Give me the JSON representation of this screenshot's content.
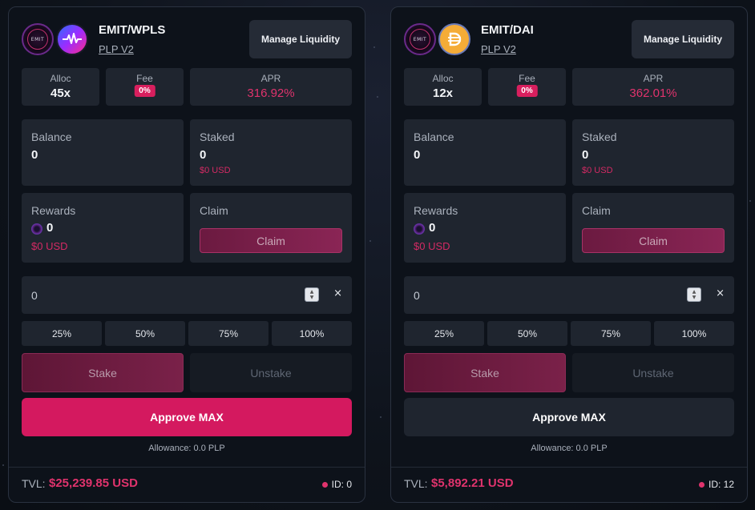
{
  "colors": {
    "accent": "#d4195f",
    "apr": "#e0336d",
    "panel": "#1f252f",
    "card": "#0d121a"
  },
  "cards": [
    {
      "pair": "EMIT/WPLS",
      "pool_type": "PLP V2",
      "logo_text": "EMIT",
      "token_icons": [
        "emit-icon",
        "pulsechain-icon"
      ],
      "manage_label": "Manage Liquidity",
      "alloc_label": "Alloc",
      "alloc_value": "45x",
      "fee_label": "Fee",
      "fee_value": "0%",
      "apr_label": "APR",
      "apr_value": "316.92%",
      "balance_label": "Balance",
      "balance_value": "0",
      "staked_label": "Staked",
      "staked_value": "0",
      "staked_usd": "$0 USD",
      "rewards_label": "Rewards",
      "rewards_value": "0",
      "rewards_usd": "$0 USD",
      "claim_title": "Claim",
      "claim_button": "Claim",
      "amount_value": "0",
      "clear_label": "×",
      "percents": [
        "25%",
        "50%",
        "75%",
        "100%"
      ],
      "stake_label": "Stake",
      "unstake_label": "Unstake",
      "approve_label": "Approve MAX",
      "allowance": "Allowance: 0.0 PLP",
      "tvl_label": "TVL:",
      "tvl_value": "$25,239.85 USD",
      "id_text": "ID: 0"
    },
    {
      "pair": "EMIT/DAI",
      "pool_type": "PLP V2",
      "logo_text": "EMIT",
      "token_icons": [
        "emit-icon",
        "dai-icon"
      ],
      "manage_label": "Manage Liquidity",
      "alloc_label": "Alloc",
      "alloc_value": "12x",
      "fee_label": "Fee",
      "fee_value": "0%",
      "apr_label": "APR",
      "apr_value": "362.01%",
      "balance_label": "Balance",
      "balance_value": "0",
      "staked_label": "Staked",
      "staked_value": "0",
      "staked_usd": "$0 USD",
      "rewards_label": "Rewards",
      "rewards_value": "0",
      "rewards_usd": "$0 USD",
      "claim_title": "Claim",
      "claim_button": "Claim",
      "amount_value": "0",
      "clear_label": "×",
      "percents": [
        "25%",
        "50%",
        "75%",
        "100%"
      ],
      "stake_label": "Stake",
      "unstake_label": "Unstake",
      "approve_label": "Approve MAX",
      "allowance": "Allowance: 0.0 PLP",
      "tvl_label": "TVL:",
      "tvl_value": "$5,892.21 USD",
      "id_text": "ID: 12"
    }
  ]
}
